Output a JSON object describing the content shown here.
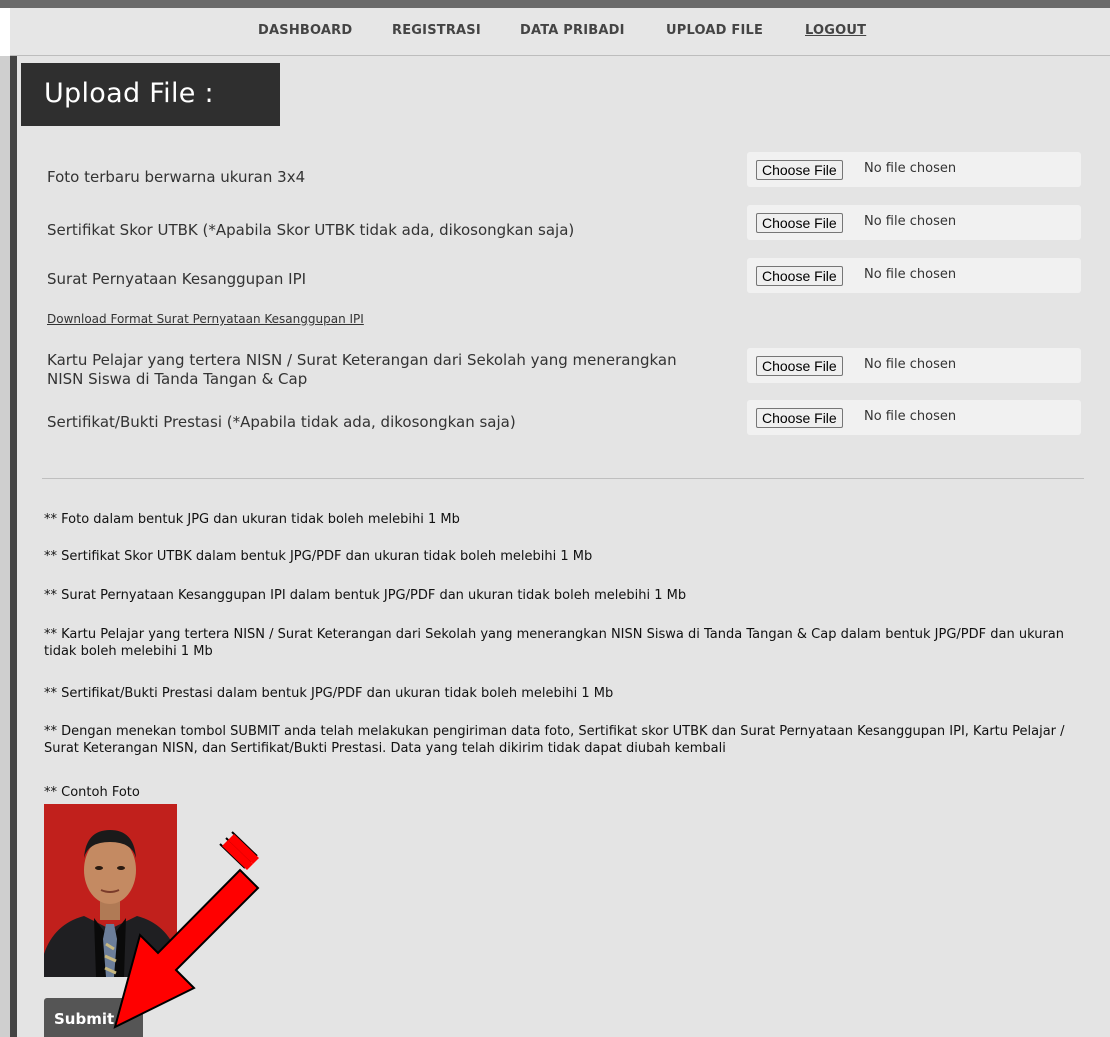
{
  "nav": {
    "items": [
      "DASHBOARD",
      "REGISTRASI",
      "DATA PRIBADI",
      "UPLOAD FILE",
      "LOGOUT"
    ]
  },
  "page": {
    "title": "Upload File :"
  },
  "form": {
    "fields": [
      {
        "label": "Foto terbaru berwarna ukuran 3x4",
        "button": "Choose File",
        "status": "No file chosen"
      },
      {
        "label": "Sertifikat Skor UTBK (*Apabila Skor UTBK tidak ada, dikosongkan saja)",
        "button": "Choose File",
        "status": "No file chosen"
      },
      {
        "label": "Surat Pernyataan Kesanggupan IPI",
        "button": "Choose File",
        "status": "No file chosen"
      },
      {
        "label": "Kartu Pelajar yang tertera NISN / Surat Keterangan dari Sekolah yang menerangkan NISN Siswa di Tanda Tangan & Cap",
        "button": "Choose File",
        "status": "No file chosen"
      },
      {
        "label": "Sertifikat/Bukti Prestasi (*Apabila tidak ada, dikosongkan saja)",
        "button": "Choose File",
        "status": "No file chosen"
      }
    ],
    "download_link": "Download Format Surat Pernyataan Kesanggupan IPI"
  },
  "notes": [
    "** Foto dalam bentuk JPG dan ukuran tidak boleh melebihi 1 Mb",
    "** Sertifikat Skor UTBK dalam bentuk JPG/PDF dan ukuran tidak boleh melebihi 1 Mb",
    "** Surat Pernyataan Kesanggupan IPI dalam bentuk JPG/PDF dan ukuran tidak boleh melebihi 1 Mb",
    "** Kartu Pelajar yang tertera NISN / Surat Keterangan dari Sekolah yang menerangkan NISN Siswa di Tanda Tangan & Cap dalam bentuk JPG/PDF dan ukuran tidak boleh melebihi 1 Mb",
    "** Sertifikat/Bukti Prestasi dalam bentuk JPG/PDF dan ukuran tidak boleh melebihi 1 Mb",
    "** Dengan menekan tombol SUBMIT anda telah melakukan pengiriman data foto, Sertifikat skor UTBK dan Surat Pernyataan Kesanggupan IPI, Kartu Pelajar / Surat Keterangan NISN, dan Sertifikat/Bukti Prestasi. Data yang telah dikirim tidak dapat diubah kembali",
    "** Contoh Foto"
  ],
  "submit_label": "Submit",
  "colors": {
    "panel_bg": "#e4e4e4",
    "title_bg": "#2f2f2f",
    "photo_bg": "#c1201c",
    "arrow": "#ff0000",
    "submit_bg": "#555555"
  }
}
